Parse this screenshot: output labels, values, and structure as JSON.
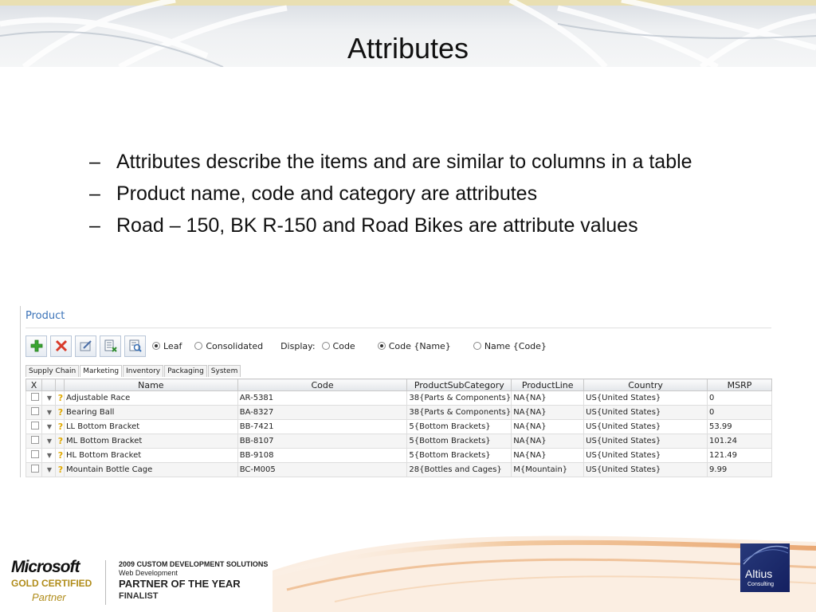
{
  "slide": {
    "title": "Attributes"
  },
  "bullets": [
    "Attributes describe the items and are similar to columns in a table",
    "Product name, code and category are attributes",
    "Road – 150, BK R-150 and Road Bikes are attribute values"
  ],
  "app": {
    "title": "Product",
    "toolbar": {
      "icons": [
        "add-icon",
        "delete-icon",
        "edit-icon",
        "export-icon",
        "view-icon"
      ]
    },
    "radio_type": {
      "leaf": "Leaf",
      "consolidated": "Consolidated",
      "selected": "Leaf"
    },
    "display_label": "Display:",
    "radio_display": {
      "code": "Code",
      "code_name": "Code {Name}",
      "name_code": "Name {Code}",
      "selected": "Code {Name}"
    },
    "tabs": [
      "Supply Chain",
      "Marketing",
      "Inventory",
      "Packaging",
      "System"
    ],
    "columns": [
      "X",
      "",
      "",
      "Name",
      "Code",
      "ProductSubCategory",
      "ProductLine",
      "Country",
      "MSRP"
    ],
    "rows": [
      {
        "name": "Adjustable Race",
        "code": "AR-5381",
        "subcat": "38{Parts & Components}",
        "line": "NA{NA}",
        "country": "US{United States}",
        "msrp": "0"
      },
      {
        "name": "Bearing Ball",
        "code": "BA-8327",
        "subcat": "38{Parts & Components}",
        "line": "NA{NA}",
        "country": "US{United States}",
        "msrp": "0"
      },
      {
        "name": "LL Bottom Bracket",
        "code": "BB-7421",
        "subcat": "5{Bottom Brackets}",
        "line": "NA{NA}",
        "country": "US{United States}",
        "msrp": "53.99"
      },
      {
        "name": "ML Bottom Bracket",
        "code": "BB-8107",
        "subcat": "5{Bottom Brackets}",
        "line": "NA{NA}",
        "country": "US{United States}",
        "msrp": "101.24"
      },
      {
        "name": "HL Bottom Bracket",
        "code": "BB-9108",
        "subcat": "5{Bottom Brackets}",
        "line": "NA{NA}",
        "country": "US{United States}",
        "msrp": "121.49"
      },
      {
        "name": "Mountain Bottle Cage",
        "code": "BC-M005",
        "subcat": "28{Bottles and Cages}",
        "line": "M{Mountain}",
        "country": "US{United States}",
        "msrp": "9.99"
      }
    ]
  },
  "footer": {
    "ms_logo": "Microsoft",
    "ms_gold": "GOLD CERTIFIED",
    "ms_partner": "Partner",
    "award_line1": "2009 CUSTOM DEVELOPMENT SOLUTIONS",
    "award_line2": "Web Development",
    "award_line3": "PARTNER OF THE YEAR",
    "award_line4": "FINALIST",
    "altius_name": "Altius",
    "altius_sub": "Consulting"
  },
  "colors": {
    "accent": "#3a72b8",
    "gold": "#b08c1a",
    "altius": "#1f2d6e"
  }
}
